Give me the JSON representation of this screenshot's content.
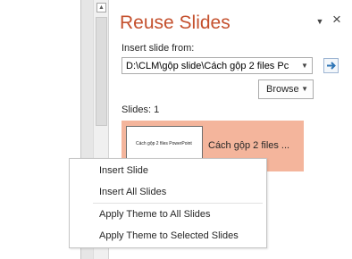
{
  "pane": {
    "title": "Reuse Slides",
    "menu_icon": "dropdown-triangle-icon",
    "close_icon": "close-icon",
    "insert_label": "Insert slide from:",
    "path_value": "D:\\CLM\\gộp slide\\Cách gộp 2 files Pc",
    "browse_label": "Browse",
    "slides_label": "Slides: 1",
    "slides": [
      {
        "thumb_title": "Cách gộp 2 files PowerPoint",
        "name": "Cách gộp 2 files ..."
      }
    ]
  },
  "context_menu": {
    "items": [
      {
        "label": "Insert Slide"
      },
      {
        "label": "Insert All Slides"
      },
      {
        "label": "Apply Theme to All Slides"
      },
      {
        "label": "Apply Theme to Selected Slides"
      }
    ]
  },
  "colors": {
    "title": "#c4502d",
    "selected_slide": "#f4b59c",
    "go_arrow": "#2e75b6"
  }
}
